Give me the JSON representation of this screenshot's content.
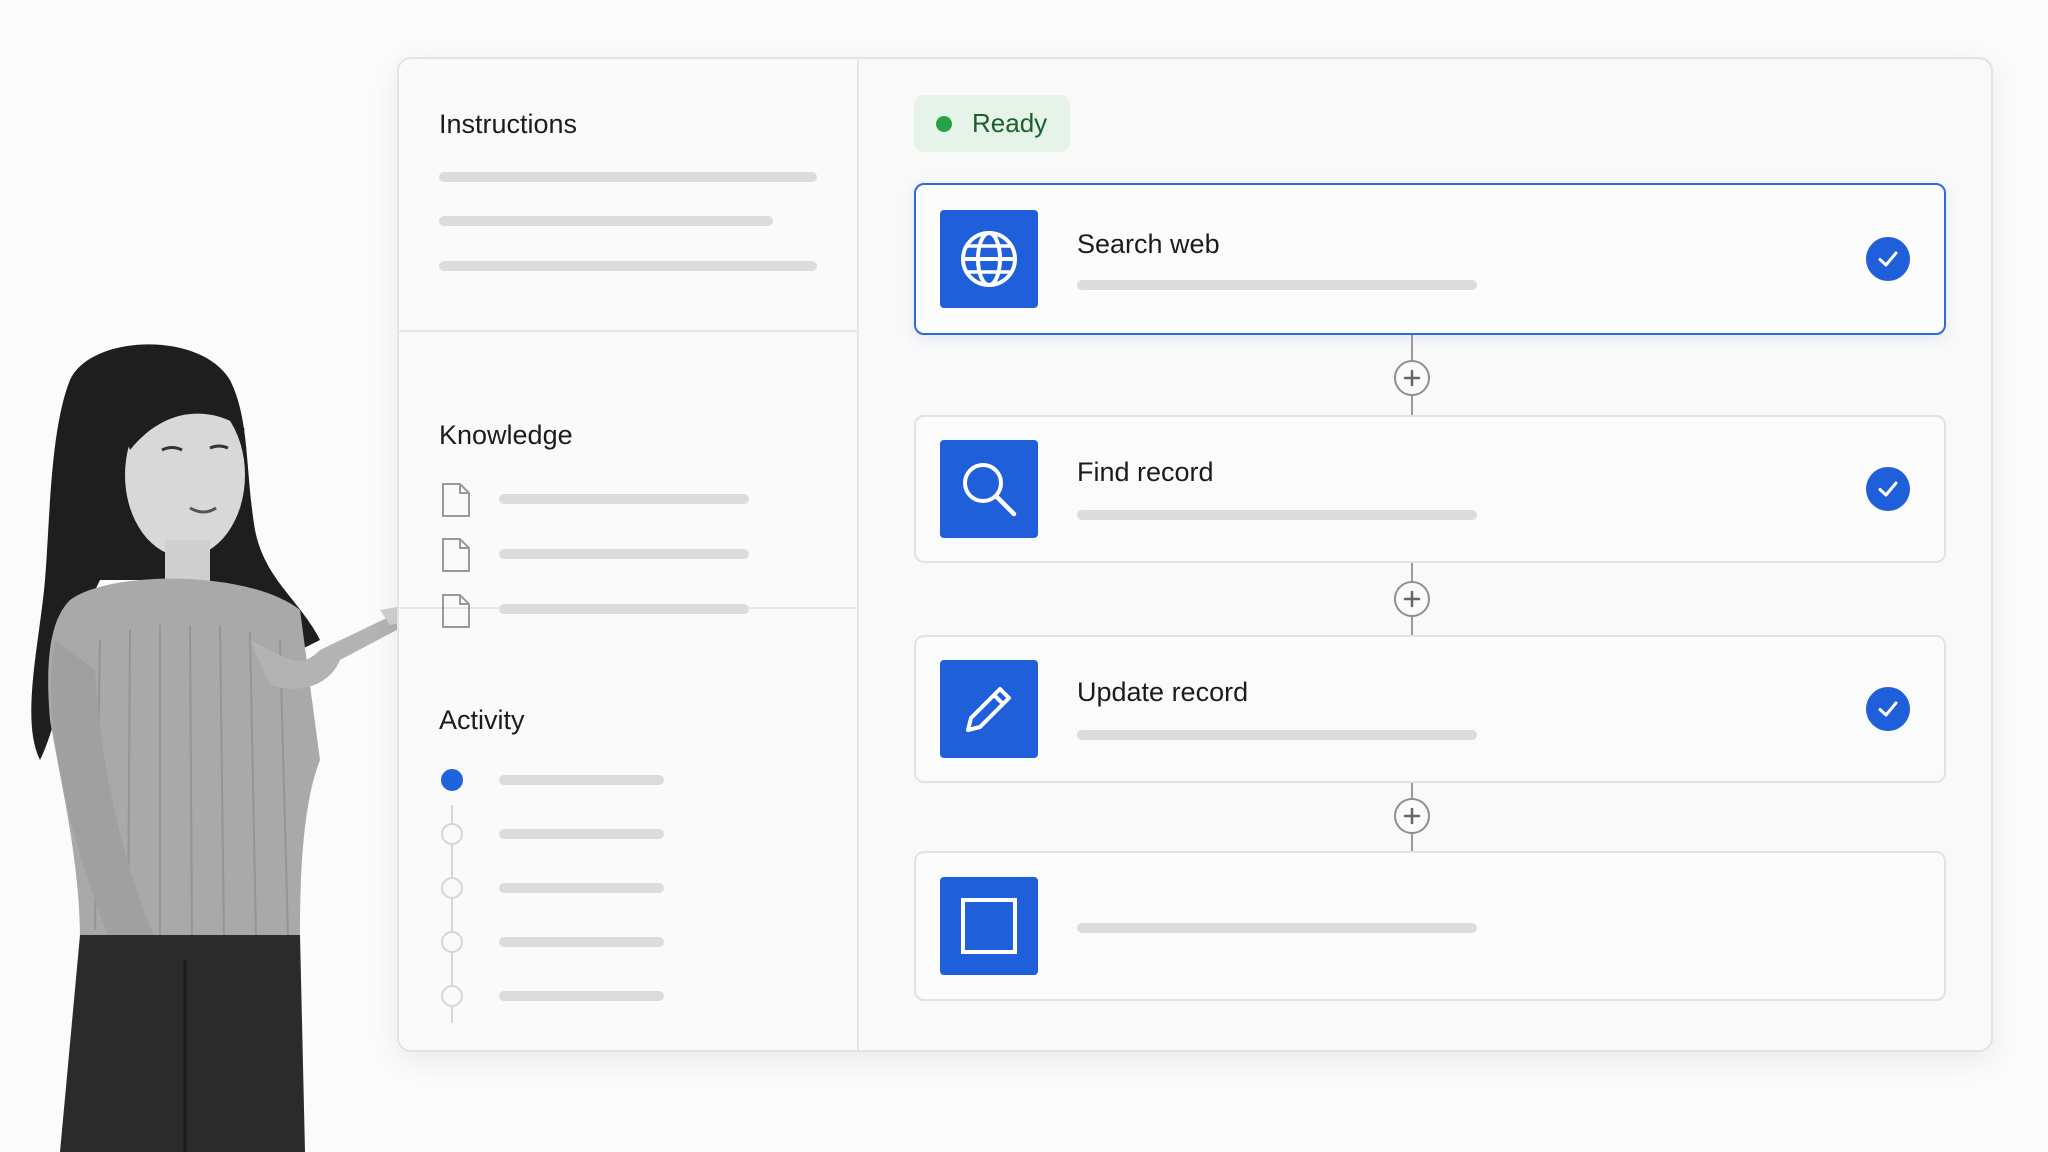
{
  "left_panel": {
    "instructions_title": "Instructions",
    "knowledge_title": "Knowledge",
    "activity_title": "Activity"
  },
  "status": {
    "label": "Ready",
    "color": "#22a34a"
  },
  "steps": [
    {
      "title": "Search web",
      "icon": "globe-icon",
      "completed": true
    },
    {
      "title": "Find record",
      "icon": "search-icon",
      "completed": true
    },
    {
      "title": "Update record",
      "icon": "pencil-icon",
      "completed": true
    },
    {
      "title": "",
      "icon": "square-icon",
      "completed": false
    }
  ],
  "accent_color": "#1f5fd9"
}
